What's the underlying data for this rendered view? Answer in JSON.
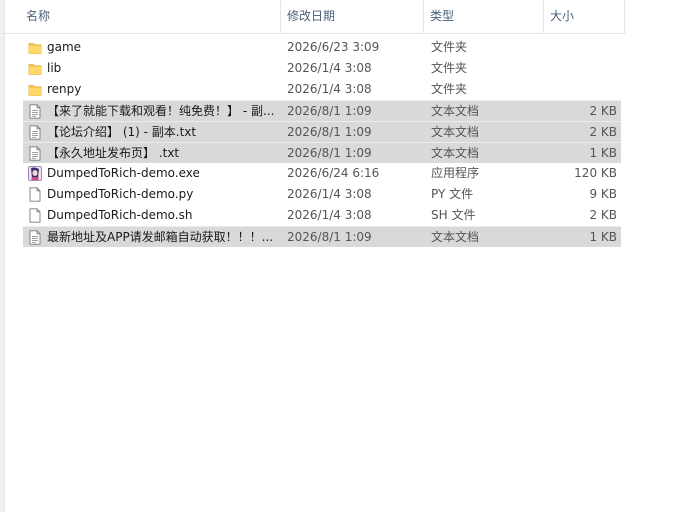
{
  "columns": {
    "name": "名称",
    "date": "修改日期",
    "type": "类型",
    "size": "大小"
  },
  "sort_indicator": "^",
  "files": [
    {
      "name": "game",
      "date": "2026/6/23 3:09",
      "type": "文件夹",
      "size": "",
      "icon": "folder-icon",
      "selected": false
    },
    {
      "name": "lib",
      "date": "2026/1/4 3:08",
      "type": "文件夹",
      "size": "",
      "icon": "folder-icon",
      "selected": false
    },
    {
      "name": "renpy",
      "date": "2026/1/4 3:08",
      "type": "文件夹",
      "size": "",
      "icon": "folder-icon",
      "selected": false
    },
    {
      "name": "【来了就能下载和观看！纯免费！】 - 副...",
      "date": "2026/8/1 1:09",
      "type": "文本文档",
      "size": "2 KB",
      "icon": "text-document-icon",
      "selected": true
    },
    {
      "name": "【论坛介绍】 (1) - 副本.txt",
      "date": "2026/8/1 1:09",
      "type": "文本文档",
      "size": "2 KB",
      "icon": "text-document-icon",
      "selected": true
    },
    {
      "name": "【永久地址发布页】 .txt",
      "date": "2026/8/1 1:09",
      "type": "文本文档",
      "size": "1 KB",
      "icon": "text-document-icon",
      "selected": true
    },
    {
      "name": "DumpedToRich-demo.exe",
      "date": "2026/6/24 6:16",
      "type": "应用程序",
      "size": "120 KB",
      "icon": "application-icon",
      "selected": false
    },
    {
      "name": "DumpedToRich-demo.py",
      "date": "2026/1/4 3:08",
      "type": "PY 文件",
      "size": "9 KB",
      "icon": "blank-file-icon",
      "selected": false
    },
    {
      "name": "DumpedToRich-demo.sh",
      "date": "2026/1/4 3:08",
      "type": "SH 文件",
      "size": "2 KB",
      "icon": "blank-file-icon",
      "selected": false
    },
    {
      "name": "最新地址及APP请发邮箱自动获取！！！...",
      "date": "2026/8/1 1:09",
      "type": "文本文档",
      "size": "1 KB",
      "icon": "text-document-icon",
      "selected": true
    }
  ]
}
